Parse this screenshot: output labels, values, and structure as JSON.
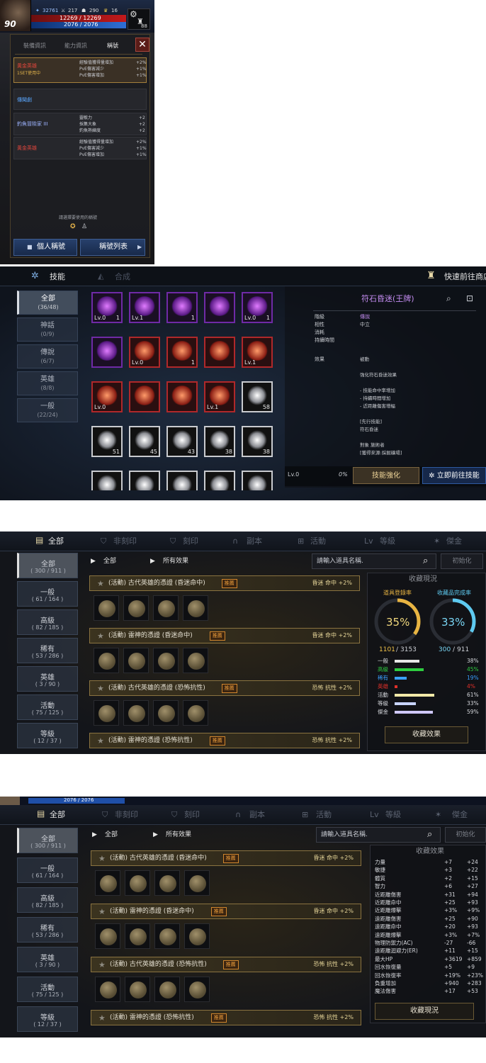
{
  "s1": {
    "level": "90",
    "stats": [
      "32761",
      "217",
      "290",
      "16"
    ],
    "hp": "12269 / 12269",
    "mp": "2076 / 2076",
    "gear_count": "88",
    "tabs": [
      "裝備資訊",
      "能力資訊",
      "稱號"
    ],
    "titles": [
      {
        "name": "黃金英雄",
        "sub": "1SET使用中",
        "effects": [
          [
            "經驗值獲得量增加",
            "+2%"
          ],
          [
            "PvE傷害減少",
            "+1%"
          ],
          [
            "PvE傷害增加",
            "+1%"
          ]
        ],
        "color": "#e0463c"
      },
      {
        "name": "傳聞劇",
        "sub": "",
        "effects": [],
        "color": "#5aa7ff"
      },
      {
        "name": "釣魚冒險家 III",
        "sub": "",
        "effects": [
          [
            "靈敏力",
            "+2"
          ],
          [
            "採集大象",
            "+2"
          ],
          [
            "釣魚熟練度",
            "+2"
          ]
        ],
        "color": "#9db4ff"
      },
      {
        "name": "黃金英雄",
        "sub": "",
        "effects": [
          [
            "經驗值獲得量增加",
            "+2%"
          ],
          [
            "PvE傷害減少",
            "+1%"
          ],
          [
            "PvE傷害增加",
            "+1%"
          ]
        ],
        "color": "#e0463c"
      }
    ],
    "hint": "請選擇要使用的稱號",
    "btn_personal": "個人稱號",
    "btn_list": "稱號列表"
  },
  "s2": {
    "tab_skill": "技能",
    "tab_compose": "合成",
    "shop": "快速前往商店",
    "nav": [
      {
        "label": "全部",
        "count": "(36/48)"
      },
      {
        "label": "神話",
        "count": "(0/9)"
      },
      {
        "label": "傳說",
        "count": "(6/7)"
      },
      {
        "label": "英雄",
        "count": "(8/8)"
      },
      {
        "label": "一般",
        "count": "(22/24)"
      }
    ],
    "cells": [
      {
        "lv": "Lv.0",
        "cnt": "1",
        "t": "p"
      },
      {
        "lv": "Lv.1",
        "cnt": "",
        "t": "p"
      },
      {
        "lv": "",
        "cnt": "1",
        "t": "p"
      },
      {
        "lv": "",
        "cnt": "",
        "t": "p"
      },
      {
        "lv": "Lv.0",
        "cnt": "1",
        "t": "p"
      },
      {
        "lv": "",
        "cnt": "",
        "t": "p"
      },
      {
        "lv": "Lv.0",
        "cnt": "",
        "t": "r"
      },
      {
        "lv": "",
        "cnt": "1",
        "t": "r"
      },
      {
        "lv": "",
        "cnt": "",
        "t": "r"
      },
      {
        "lv": "Lv.1",
        "cnt": "",
        "t": "r"
      },
      {
        "lv": "Lv.0",
        "cnt": "",
        "t": "r"
      },
      {
        "lv": "",
        "cnt": "",
        "t": "r"
      },
      {
        "lv": "",
        "cnt": "",
        "t": "r"
      },
      {
        "lv": "Lv.1",
        "cnt": "",
        "t": "r"
      },
      {
        "lv": "",
        "cnt": "58",
        "t": "w"
      },
      {
        "lv": "",
        "cnt": "51",
        "t": "w"
      },
      {
        "lv": "",
        "cnt": "45",
        "t": "w"
      },
      {
        "lv": "",
        "cnt": "43",
        "t": "w"
      },
      {
        "lv": "",
        "cnt": "38",
        "t": "w"
      },
      {
        "lv": "",
        "cnt": "38",
        "t": "w"
      },
      {
        "lv": "",
        "cnt": "",
        "t": "w"
      },
      {
        "lv": "",
        "cnt": "",
        "t": "w"
      },
      {
        "lv": "",
        "cnt": "",
        "t": "w"
      },
      {
        "lv": "",
        "cnt": "",
        "t": "w"
      },
      {
        "lv": "",
        "cnt": "",
        "t": "w"
      }
    ],
    "detail_title": "符石昏迷(王牌)",
    "detail_rows": [
      [
        "階級",
        "傳說"
      ],
      [
        "相性",
        "中立"
      ],
      [
        "消耗",
        ""
      ],
      [
        "持續時間",
        ""
      ]
    ],
    "effect_label": "效果",
    "effect_lines": [
      "被動",
      "",
      "強化符石昏迷效果",
      "",
      "- 技能命中率增加",
      "- 持續時間增加",
      "- 近距離傷害增幅",
      "",
      "[先行技能]",
      "符石昏迷",
      "",
      "對象 施術者",
      "[獲得來源:採掘礦場]"
    ],
    "lv": "Lv.0",
    "pct": "0%",
    "btn_enhance": "技能強化",
    "btn_go": "立即前往技能"
  },
  "col": {
    "tabs": [
      "全部",
      "非刻印",
      "刻印",
      "副本",
      "活動",
      "等級",
      "傑金"
    ],
    "filter1": "全部",
    "filter2": "所有效果",
    "search_ph": "請輸入道具名稱.",
    "reset": "初始化",
    "nav": [
      {
        "label": "全部",
        "count": "( 300 / 911 )"
      },
      {
        "label": "一般",
        "count": "( 61 / 164 )"
      },
      {
        "label": "高級",
        "count": "( 82 / 185 )"
      },
      {
        "label": "稀有",
        "count": "( 53 / 286 )"
      },
      {
        "label": "英雄",
        "count": "( 3 / 90 )"
      },
      {
        "label": "活動",
        "count": "( 75 / 125 )"
      },
      {
        "label": "等級",
        "count": "( 12 / 37 )"
      }
    ],
    "items": [
      {
        "name": "(活動) 古代英雄的憑證 (昏迷命中)",
        "tag": "推薦",
        "effect": "昏迷 命中 +2%"
      },
      {
        "name": "(活動) 雷神的憑證 (昏迷命中)",
        "tag": "推薦",
        "effect": "昏迷 命中 +2%"
      },
      {
        "name": "(活動) 古代英雄的憑證 (恐怖抗性)",
        "tag": "推薦",
        "effect": "恐怖 抗性 +2%"
      },
      {
        "name": "(活動) 雷神的憑證 (恐怖抗性)",
        "tag": "推薦",
        "effect": "恐怖 抗性 +2%"
      }
    ],
    "status_title": "收藏現況",
    "rate1_label": "道具登錄率",
    "rate2_label": "收藏品完成率",
    "rate1": "35%",
    "rate2": "33%",
    "rate1_frac": 0.35,
    "rate2_frac": 0.33,
    "count1": "1101",
    "total1": "3153",
    "count2": "300",
    "total2": "911",
    "grades": [
      {
        "name": "一般",
        "pct": "38%",
        "v": 0.38,
        "color": "#e6e6e6"
      },
      {
        "name": "高級",
        "pct": "45%",
        "v": 0.45,
        "color": "#2ecc40"
      },
      {
        "name": "稀有",
        "pct": "19%",
        "v": 0.19,
        "color": "#3aa0ff"
      },
      {
        "name": "英雄",
        "pct": "4%",
        "v": 0.04,
        "color": "#e0302a"
      },
      {
        "name": "活動",
        "pct": "61%",
        "v": 0.61,
        "color": "#f2e9a8"
      },
      {
        "name": "等級",
        "pct": "33%",
        "v": 0.33,
        "color": "#c8d4ff"
      },
      {
        "name": "傑金",
        "pct": "59%",
        "v": 0.59,
        "color": "#cfc8ff"
      }
    ],
    "btn_effect": "收藏效果",
    "eff_title": "收藏效果",
    "eff_rows": [
      [
        "力量",
        "+7",
        "+24"
      ],
      [
        "敏捷",
        "+3",
        "+22"
      ],
      [
        "體質",
        "+2",
        "+15"
      ],
      [
        "智力",
        "+6",
        "+27"
      ],
      [
        "近距離傷害",
        "+31",
        "+94"
      ],
      [
        "近距離命中",
        "+25",
        "+93"
      ],
      [
        "近距離爆擊",
        "+3%",
        "+9%"
      ],
      [
        "遠距離傷害",
        "+25",
        "+90"
      ],
      [
        "遠距離命中",
        "+20",
        "+93"
      ],
      [
        "遠距離爆擊",
        "+3%",
        "+7%"
      ],
      [
        "物理防禦力(AC)",
        "-27",
        "-66"
      ],
      [
        "遠距離迴避力(ER)",
        "+11",
        "+15"
      ],
      [
        "最大HP",
        "+3619",
        "+859"
      ],
      [
        "回水恢復量",
        "+5",
        "+9"
      ],
      [
        "回水恢復率",
        "+19%",
        "+23%"
      ],
      [
        "負重增加",
        "+940",
        "+283"
      ],
      [
        "魔法傷害",
        "+17",
        "+53"
      ]
    ],
    "btn_status": "收藏現況",
    "s4_hud": "2076 / 2076"
  }
}
